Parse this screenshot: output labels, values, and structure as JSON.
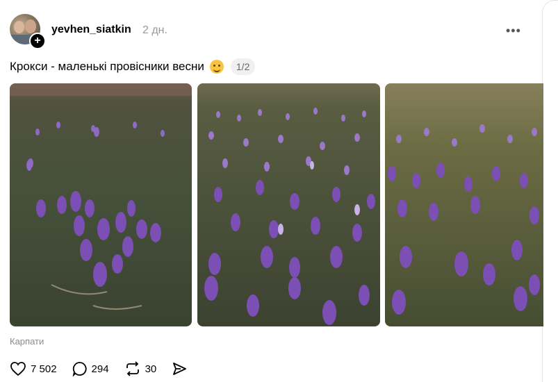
{
  "post": {
    "author": {
      "username": "yevhen_siatkin",
      "time": "2 дн."
    },
    "caption": "Крокси - маленькі провісники весни",
    "emoji": "smiling-face-emoji",
    "image_counter": "1/2",
    "location": "Карпати",
    "actions": {
      "likes": "7 502",
      "comments": "294",
      "reposts": "30"
    }
  },
  "icons": [
    "plus-icon",
    "more-icon",
    "heart-icon",
    "comment-icon",
    "repost-icon",
    "share-icon"
  ],
  "colors": {
    "crocus": "#7b4fb3",
    "grass": "#5c6a3c"
  }
}
